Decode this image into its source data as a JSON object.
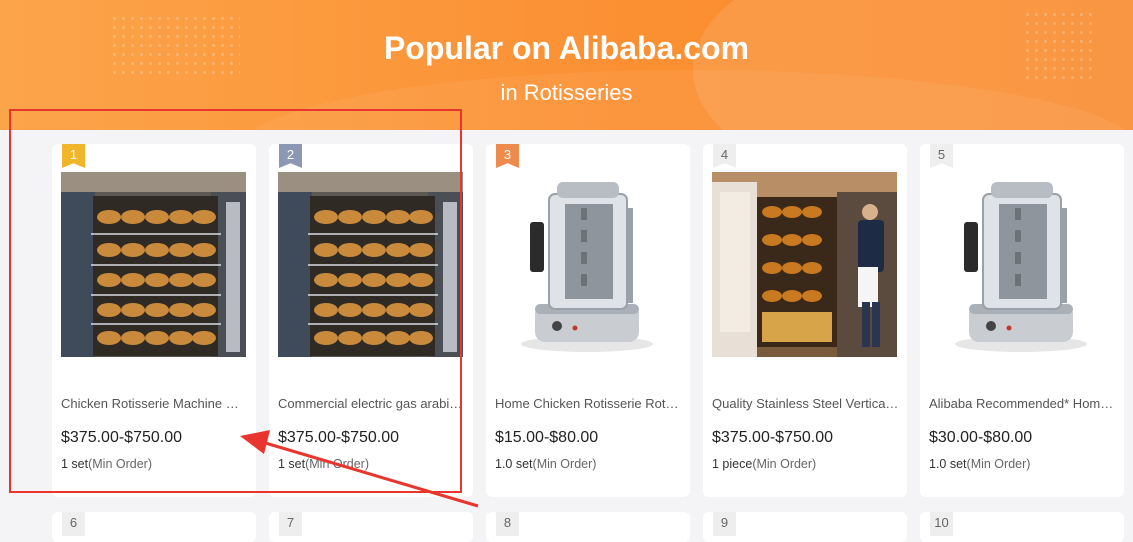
{
  "header": {
    "title": "Popular on Alibaba.com",
    "subtitle": "in Rotisseries"
  },
  "products": [
    {
      "rank": "1",
      "name": "Chicken Rotisserie Machine Ga...",
      "price": "$375.00-$750.00",
      "moq_value": "1 set",
      "moq_label": "(Min Order)",
      "image": "rotisserie-rack-photo",
      "badge_color": "#f0b528"
    },
    {
      "rank": "2",
      "name": "Commercial electric gas arabic...",
      "price": "$375.00-$750.00",
      "moq_value": "1 set",
      "moq_label": "(Min Order)",
      "image": "rotisserie-rack-photo",
      "badge_color": "#8c98b3"
    },
    {
      "rank": "3",
      "name": "Home Chicken Rotisserie Rota...",
      "price": "$15.00-$80.00",
      "moq_value": "1.0 set",
      "moq_label": "(Min Order)",
      "image": "vertical-rotisserie-photo",
      "badge_color": "#ee8a4c"
    },
    {
      "rank": "4",
      "name": "Quality Stainless Steel Vertical ...",
      "price": "$375.00-$750.00",
      "moq_value": "1 piece",
      "moq_label": "(Min Order)",
      "image": "shop-rotisserie-photo",
      "badge_color": "#eeeeee"
    },
    {
      "rank": "5",
      "name": "Alibaba Recommended* Home...",
      "price": "$30.00-$80.00",
      "moq_value": "1.0 set",
      "moq_label": "(Min Order)",
      "image": "vertical-rotisserie-photo",
      "badge_color": "#eeeeee"
    }
  ],
  "next_row_ranks": [
    "6",
    "7",
    "8",
    "9",
    "10"
  ],
  "annotation": {
    "color": "#e8352e"
  }
}
